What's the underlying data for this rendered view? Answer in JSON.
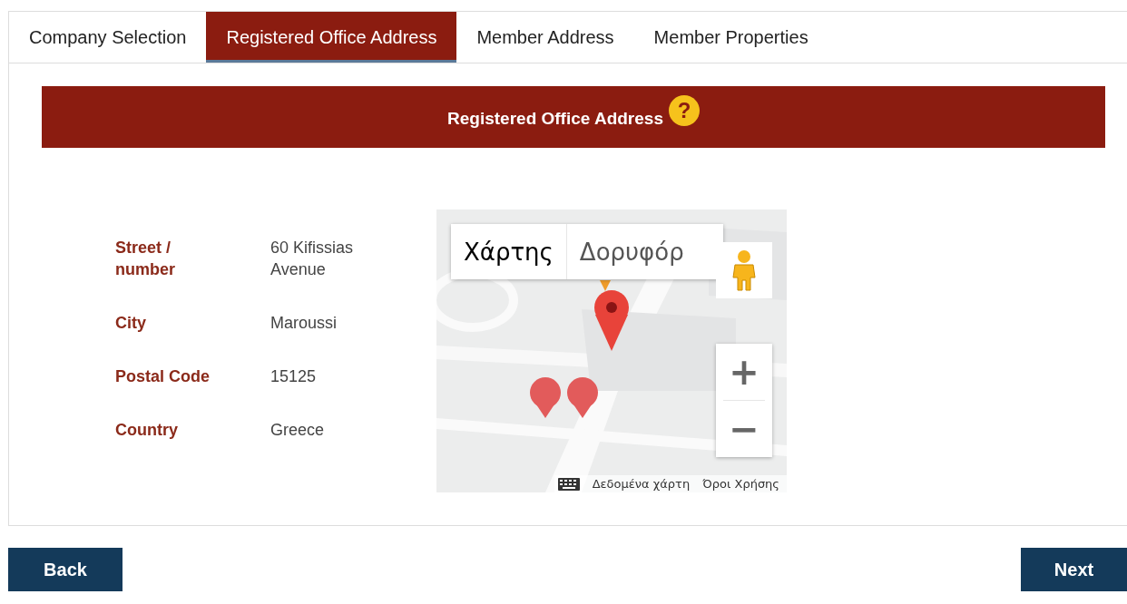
{
  "tabs": [
    {
      "label": "Company Selection",
      "selected": false
    },
    {
      "label": "Registered Office Address",
      "selected": true
    },
    {
      "label": "Member Address",
      "selected": false
    },
    {
      "label": "Member Properties",
      "selected": false
    }
  ],
  "banner": {
    "title": "Registered Office Address",
    "help": "?"
  },
  "fields": [
    {
      "label": "Street / number",
      "value": "60 Kifissias Avenue"
    },
    {
      "label": "City",
      "value": "Maroussi"
    },
    {
      "label": "Postal Code",
      "value": "15125"
    },
    {
      "label": "Country",
      "value": "Greece"
    }
  ],
  "map": {
    "type_buttons": [
      {
        "label": "Χάρτης",
        "selected": true
      },
      {
        "label": "Δορυφόρ",
        "selected": false
      }
    ],
    "zoom_in": "+",
    "zoom_out": "−",
    "footer": [
      "Δεδομένα χάρτη",
      "Όροι Χρήσης"
    ]
  },
  "buttons": {
    "back": "Back",
    "next": "Next"
  }
}
